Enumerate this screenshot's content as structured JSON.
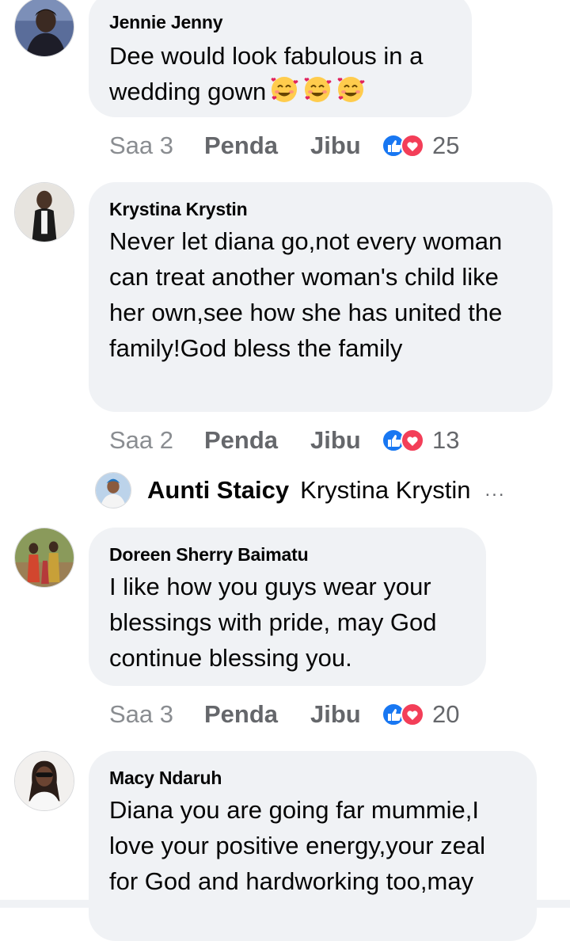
{
  "comments": [
    {
      "author": "Jennie Jenny",
      "text": "Dee would look fabulous in a wedding gown",
      "emoji": "smiling-face-with-hearts-emoji",
      "emoji_count": 3,
      "time": "Saa 3",
      "like_label": "Penda",
      "reply_label": "Jibu",
      "reaction_count": "25"
    },
    {
      "author": "Krystina Krystin",
      "text": "Never let diana go,not every woman can treat another woman's child like her own,see how she has united the family!God bless the family",
      "time": "Saa 2",
      "like_label": "Penda",
      "reply_label": "Jibu",
      "reaction_count": "13"
    },
    {
      "author": "Doreen Sherry Baimatu",
      "text": "I like how you guys wear your blessings with pride, may God continue blessing you.",
      "time": "Saa 3",
      "like_label": "Penda",
      "reply_label": "Jibu",
      "reaction_count": "20"
    },
    {
      "author": "Macy Ndaruh",
      "text": "Diana you are going far mummie,I love your positive energy,your zeal for God and hardworking too,may"
    }
  ],
  "reply_preview": {
    "author": "Aunti Staicy",
    "text": "Krystina Krystin",
    "more": "..."
  },
  "icons": {
    "like": "like-reaction-icon",
    "love": "love-reaction-icon"
  },
  "colors": {
    "bubble": "#f0f2f5",
    "meta_text": "#65676b",
    "like_blue": "#1877f2",
    "love_red": "#f33e58"
  }
}
